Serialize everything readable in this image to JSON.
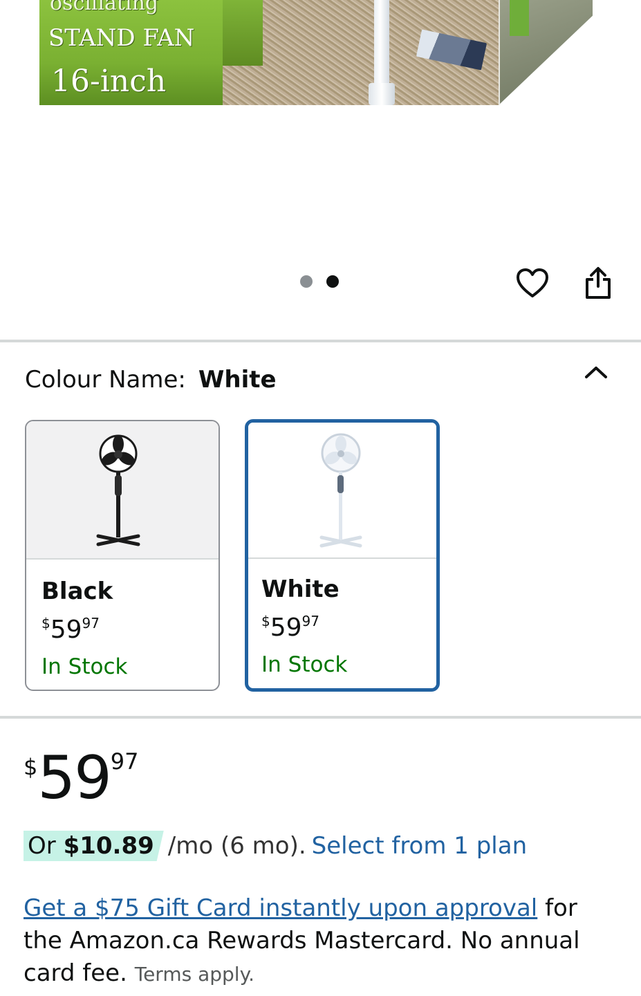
{
  "hero": {
    "image_text_line1": "oscillating",
    "image_text_line2": "STAND FAN",
    "image_text_line3": "16-inch",
    "carousel": {
      "total": 2,
      "active_index": 2
    },
    "icons": {
      "wishlist": "heart-icon",
      "share": "share-icon"
    }
  },
  "variation": {
    "label": "Colour Name:",
    "selected_value": "White",
    "collapse_icon": "chevron-up-icon",
    "options": [
      {
        "name": "Black",
        "currency": "$",
        "whole": "59",
        "fraction": "97",
        "stock": "In Stock",
        "selected": false
      },
      {
        "name": "White",
        "currency": "$",
        "whole": "59",
        "fraction": "97",
        "stock": "In Stock",
        "selected": true
      }
    ]
  },
  "price": {
    "currency": "$",
    "whole": "59",
    "fraction": "97"
  },
  "installment": {
    "prefix": "Or ",
    "amount": "$10.89",
    "term": "/mo (6 mo).",
    "link": "Select from 1 plan"
  },
  "promo": {
    "link": "Get a $75 Gift Card instantly upon approval",
    "text": " for the Amazon.ca Rewards Mastercard. No annual card fee.",
    "terms": "Terms apply."
  },
  "colors": {
    "link": "#2162a1",
    "in_stock": "#007600",
    "selected_border": "#2162a1",
    "installment_chip": "#c6f2e6",
    "divider": "#d5d9d9"
  }
}
